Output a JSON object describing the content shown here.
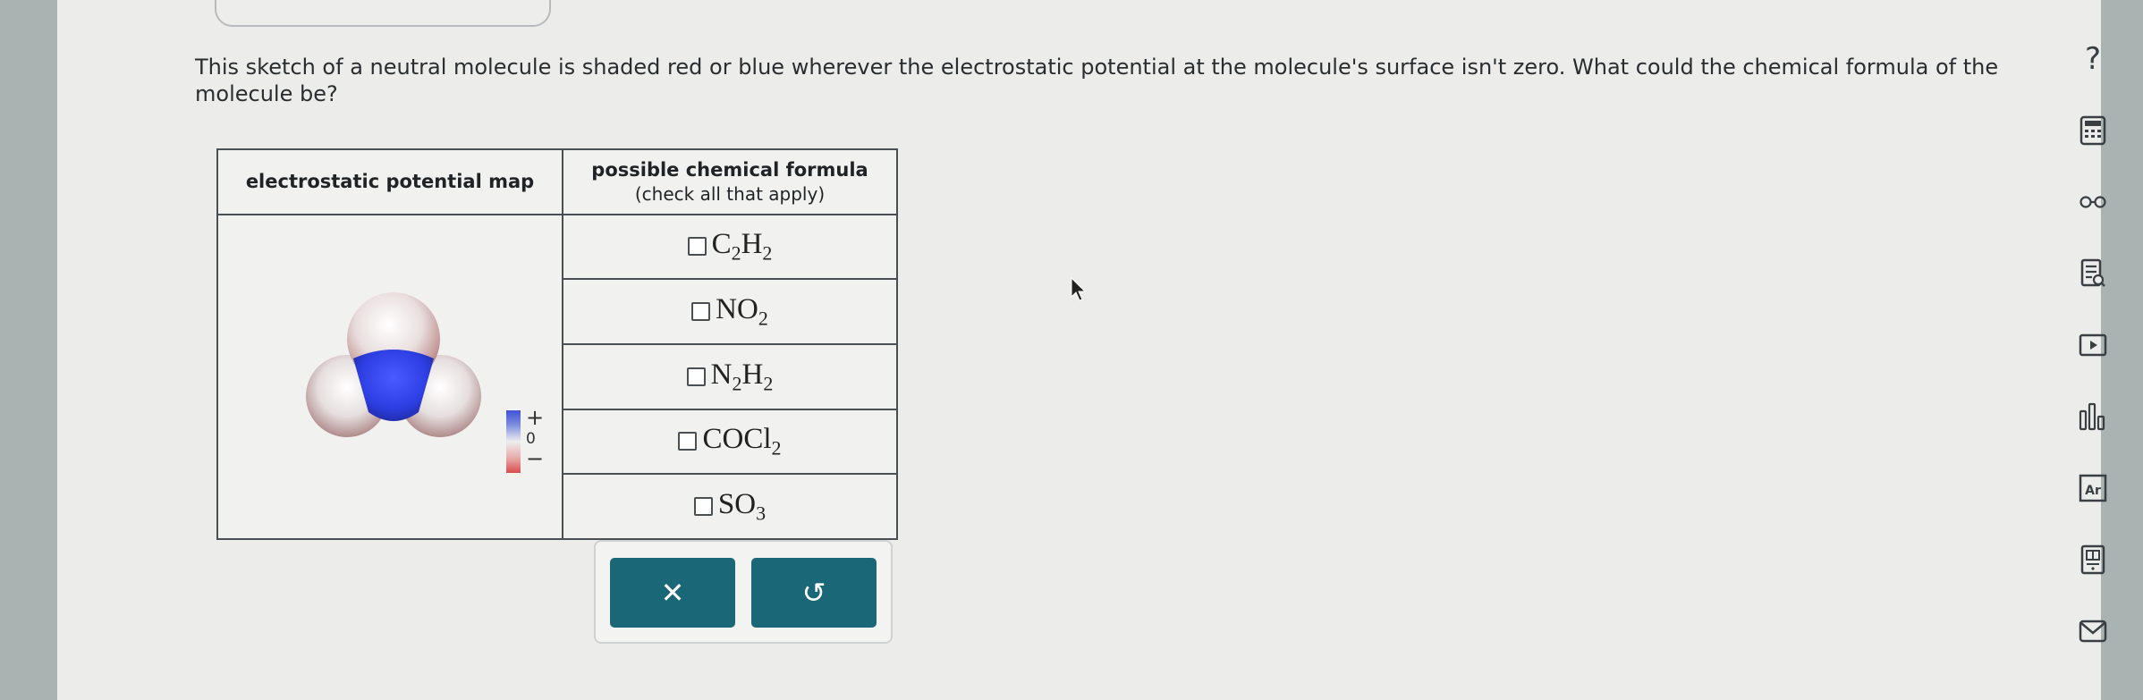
{
  "question": {
    "text": "This sketch of a neutral molecule is shaded red or blue wherever the electrostatic potential at the molecule's surface isn't zero. What could the chemical formula of the molecule be?"
  },
  "table": {
    "col1_header": "electrostatic potential map",
    "col2_header": "possible chemical formula",
    "col2_subheader": "(check all that apply)",
    "options": [
      {
        "parts": [
          [
            "C",
            "2"
          ],
          [
            "H",
            "2"
          ]
        ],
        "checked": false
      },
      {
        "parts": [
          [
            "NO",
            "2"
          ]
        ],
        "checked": false
      },
      {
        "parts": [
          [
            "N",
            "2"
          ],
          [
            "H",
            "2"
          ]
        ],
        "checked": false
      },
      {
        "parts": [
          [
            "COCl",
            "2"
          ]
        ],
        "checked": false
      },
      {
        "parts": [
          [
            "SO",
            "3"
          ]
        ],
        "checked": false
      }
    ]
  },
  "legend": {
    "plus": "+",
    "zero": "0",
    "minus": "−"
  },
  "buttons": {
    "clear_symbol": "✕",
    "undo_symbol": "↺"
  },
  "sidebar": {
    "icons": [
      "help-icon",
      "calculator-icon",
      "glasses-icon",
      "notes-icon",
      "video-icon",
      "chart-icon",
      "periodic-table-icon",
      "textbook-icon",
      "mail-icon"
    ],
    "help_label": "?"
  },
  "colors": {
    "button": "#1a6777",
    "positive": "#3f54d6",
    "negative": "#d94b4b"
  }
}
